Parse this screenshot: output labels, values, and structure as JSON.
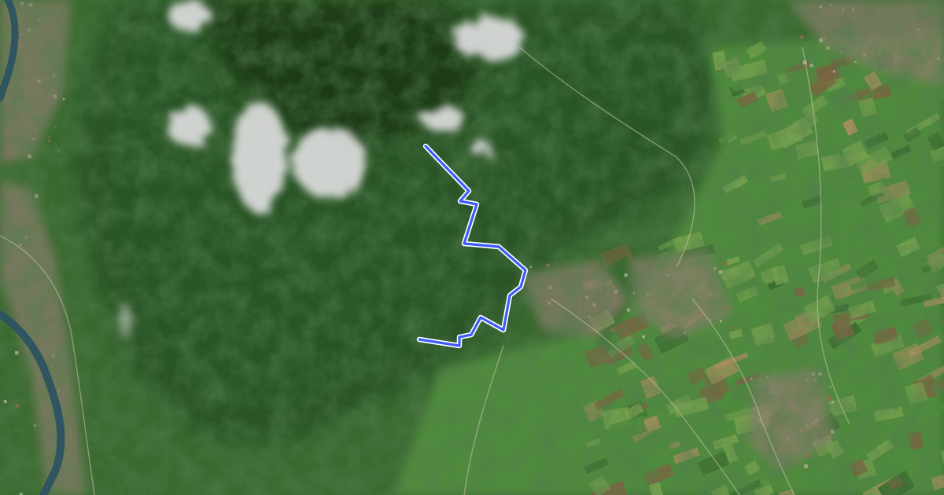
{
  "map": {
    "type": "satellite",
    "route_style": {
      "color": "#3b5cff",
      "outline": "#ffffff"
    },
    "palette": {
      "forest_dark": "#1c3a18",
      "forest": "#2c5426",
      "forest_mid": "#3a6a30",
      "field_green": "#4f8a3c",
      "field_light": "#79a24f",
      "field_tan": "#a88f5e",
      "field_brown": "#7d6241",
      "urban": "#8b7d6c",
      "urban_roof": "#a4644c",
      "river": "#2f5560",
      "cloud": "#dcdcdc"
    }
  }
}
